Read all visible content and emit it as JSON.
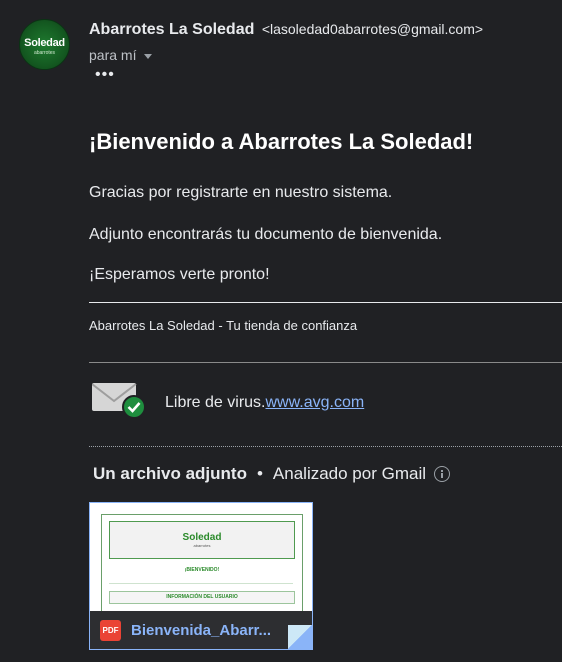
{
  "sender": {
    "name": "Abarrotes La Soledad",
    "email": "<lasoledad0abarrotes@gmail.com>",
    "avatar_text": "Soledad",
    "avatar_sub": "abarrotes"
  },
  "recipient": {
    "label": "para mí"
  },
  "more_label": "•••",
  "message": {
    "title": "¡Bienvenido a Abarrotes La Soledad!",
    "line1": "Gracias por registrarte en nuestro sistema.",
    "line2": "Adjunto encontrarás tu documento de bienvenida.",
    "line3": "¡Esperamos verte pronto!",
    "footer": "Abarrotes La Soledad - Tu tienda de confianza"
  },
  "avg": {
    "text": "Libre de virus.",
    "link": "www.avg.com"
  },
  "attachments": {
    "count_label": "Un archivo adjunto",
    "separator": "•",
    "scan_label": "Analizado por Gmail",
    "file": {
      "name": "Bienvenida_Abarr...",
      "type_label": "PDF",
      "preview": {
        "logo": "Soledad",
        "logo_sub": "abarrotes",
        "welcome": "¡BIENVENIDO!",
        "section": "INFORMACIÓN DEL USUARIO"
      }
    }
  },
  "colors": {
    "background": "#202124",
    "link": "#8ab4f8",
    "pdf": "#ea4335",
    "check": "#1e8e3e"
  }
}
